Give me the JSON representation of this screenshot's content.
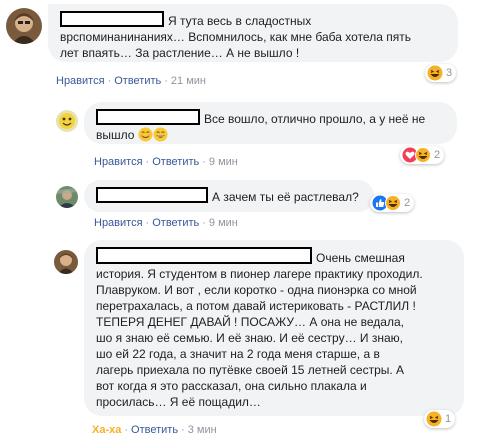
{
  "comments": [
    {
      "text": "Я тута весь в сладостных врспоминанинаниях… Вспомнилось, как мне баба хотела пять лет впаять… За растление… А не вышло !",
      "line1": "Я тута весь в сладостных",
      "line2": "врспоминанинаниях… Вспомнилось, как мне баба хотела пять",
      "line3": "лет впаять… За растление… А не вышло !",
      "like": "Нравится",
      "reply": "Ответить",
      "time": "21 мин",
      "reaction_count": "3",
      "reaction_icons": [
        "haha-icon"
      ]
    },
    {
      "line1": "Все вошло, отлично прошло, а у неё не",
      "line2": "вышло",
      "like": "Нравится",
      "reply": "Ответить",
      "time": "9 мин",
      "reaction_count": "2",
      "reaction_icons": [
        "love-icon",
        "haha-icon"
      ]
    },
    {
      "line1": "А зачем ты её растлевал?",
      "like": "Нравится",
      "reply": "Ответить",
      "time": "9 мин",
      "reaction_count": "2",
      "reaction_icons": [
        "like-icon",
        "haha-icon"
      ]
    },
    {
      "line1": "Очень смешная",
      "line2": "история. Я студентом в пионер лагере практику проходил.",
      "line3": "Плавруком. И вот , если коротко - одна пионэрка со мной",
      "line4": "перетрахалась, а потом давай истериковать - РАСТЛИЛ !",
      "line5": "ТЕПЕРЯ ДЕНЕГ ДАВАЙ ! ПОСАЖУ… А она не ведала,",
      "line6": "шо я знаю её семью. И её знаю. И её сестру… И знаю,",
      "line7": "шо ей 22 года, а значит на 2 года меня старше, а в",
      "line8": "лагерь приехала по путёвке своей 15 летней сестры. А",
      "line9": "вот когда я это рассказал, она сильно плакала и",
      "line10": "просилась… Я её пощадил…",
      "like": "Ха-ха",
      "reply": "Ответить",
      "time": "3 мин",
      "reaction_count": "1",
      "reaction_icons": [
        "haha-icon"
      ]
    }
  ],
  "colors": {
    "link": "#385898",
    "meta": "#90949c",
    "bubble": "#f2f3f5",
    "haha": "#f7b125",
    "love": "#f33e58",
    "like": "#1877f2"
  }
}
